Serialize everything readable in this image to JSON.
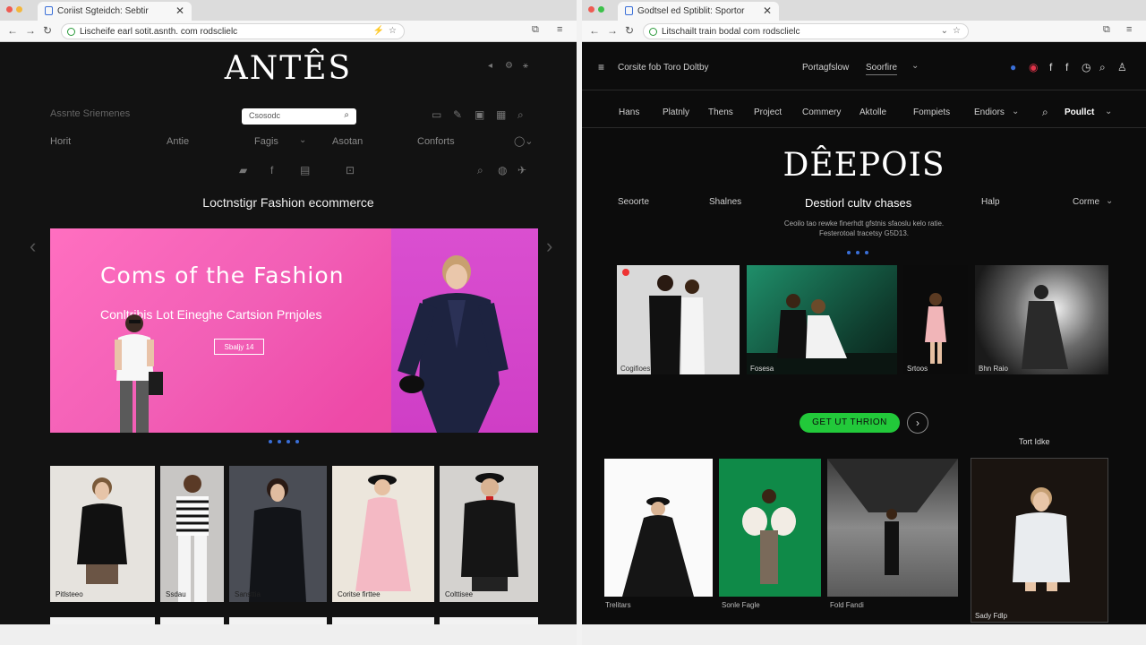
{
  "left_window": {
    "tab_title": "Coriist Sgteidch: Sebtir",
    "url": "Lischeife earl sotit.asnth. com rodsclielc",
    "site": {
      "logo": "ANTÊS",
      "breadcrumb": "Assnte Sriemenes",
      "search_placeholder": "Csosodc",
      "nav": [
        "Horit",
        "Antie",
        "Fagis",
        "Asotan",
        "Conforts"
      ],
      "section_title": "Loctnstigr Fashion ecommerce",
      "hero": {
        "headline": "Coms of the Fashion",
        "subheadline": "Conltribis Lot Eineghe Cartsion Prnjoles",
        "button_label": "Sbaljy 14"
      },
      "products": [
        {
          "caption": "Pitlsteeo"
        },
        {
          "caption": "Ssdau"
        },
        {
          "caption": "Sansttia"
        },
        {
          "caption": "Coritse firttee"
        },
        {
          "caption": "Colttisee"
        }
      ]
    }
  },
  "right_window": {
    "tab_title": "Godtsel ed Sptiblit: Sportor",
    "url": "Litschailt train bodal com rodsclielc",
    "site": {
      "brand_line": "Corsite fob Toro Doltby",
      "top_links": [
        "Portagfslow",
        "Soorfire"
      ],
      "nav": [
        "Hans",
        "Platnly",
        "Thens",
        "Project",
        "Commery",
        "Aktolle",
        "Fompiets",
        "Endiors"
      ],
      "nav_highlight": "Poullct",
      "logo": "DÊEPOIS",
      "sub_nav_left": [
        "Seoorte",
        "Shalnes"
      ],
      "sub_title": "Destiorl cultv chases",
      "sub_nav_right": [
        "Halp",
        "Corme"
      ],
      "description": [
        "Ceoilo tao rewke finerhdt gfstnis sfaoslu kelo ratie.",
        "Festerotoal tracetsy G5D13."
      ],
      "gallery": [
        {
          "caption": "Cogifioes"
        },
        {
          "caption": "Fosesa"
        },
        {
          "caption": "Srtoos"
        },
        {
          "caption": "Bhn Raio"
        }
      ],
      "cta_label": "GET UT THRION",
      "side_label": "Tort Idke",
      "products": [
        {
          "caption": "Trelitars"
        },
        {
          "caption": "Sonle Fagle"
        },
        {
          "caption": "Fold Fandi"
        },
        {
          "caption": "Sady Fdlp"
        }
      ]
    }
  },
  "colors": {
    "hero_pink": "#f25fb6",
    "cta_green": "#22c93a",
    "accent_blue": "#3a6fd8"
  },
  "icons": [
    "back-icon",
    "forward-icon",
    "reload-icon",
    "lock-icon",
    "star-icon",
    "menu-icon",
    "search-icon",
    "user-icon"
  ]
}
